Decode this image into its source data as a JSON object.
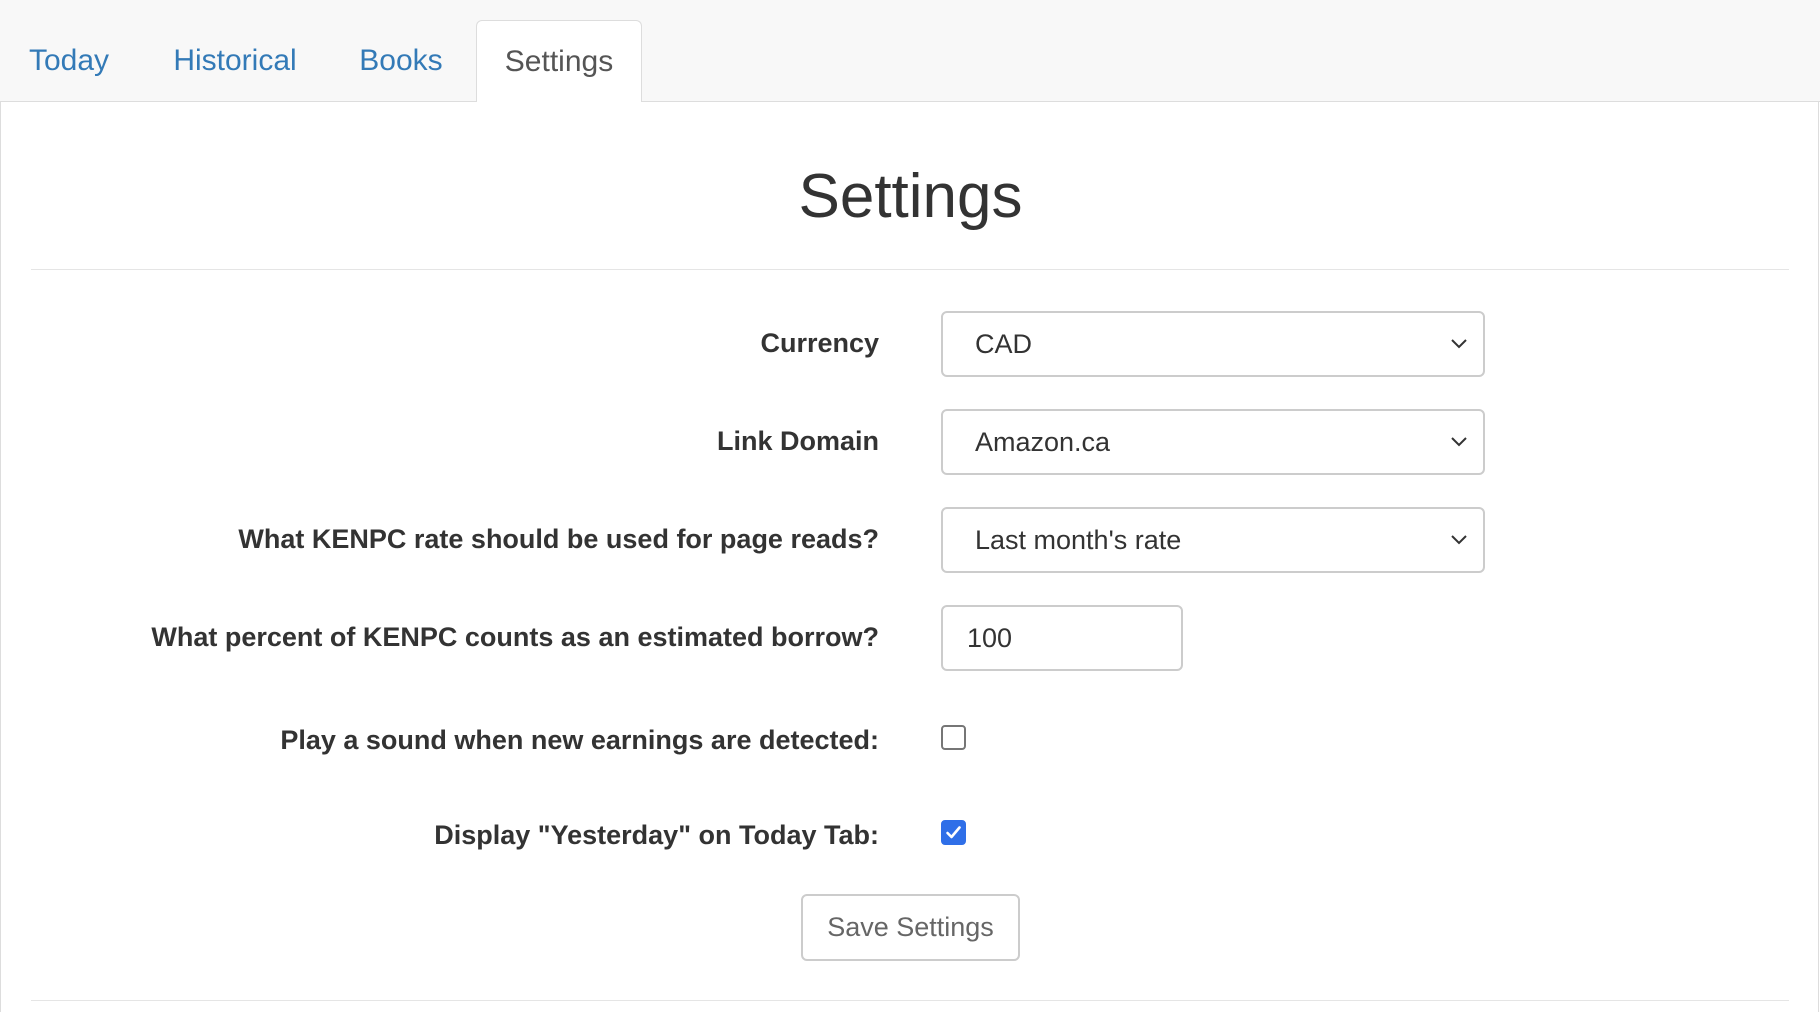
{
  "tabs": [
    {
      "label": "Today",
      "active": false
    },
    {
      "label": "Historical",
      "active": false
    },
    {
      "label": "Books",
      "active": false
    },
    {
      "label": "Settings",
      "active": true
    }
  ],
  "page": {
    "title": "Settings"
  },
  "form": {
    "currency": {
      "label": "Currency",
      "selected": "CAD",
      "icon": "chevron-down-icon"
    },
    "link_domain": {
      "label": "Link Domain",
      "selected": "Amazon.ca",
      "icon": "chevron-down-icon"
    },
    "kenpc_rate": {
      "label": "What KENPC rate should be used for page reads?",
      "selected": "Last month's rate",
      "icon": "chevron-down-icon"
    },
    "borrow_percent": {
      "label": "What percent of KENPC counts as an estimated borrow?",
      "value": "100"
    },
    "play_sound": {
      "label": "Play a sound when new earnings are detected:",
      "checked": false
    },
    "display_yesterday": {
      "label": "Display \"Yesterday\" on Today Tab:",
      "checked": true,
      "icon": "checkmark-icon"
    },
    "save_label": "Save Settings"
  },
  "colors": {
    "link": "#337ab7",
    "checkbox_checked": "#2f6fe8",
    "border": "#cccccc"
  }
}
